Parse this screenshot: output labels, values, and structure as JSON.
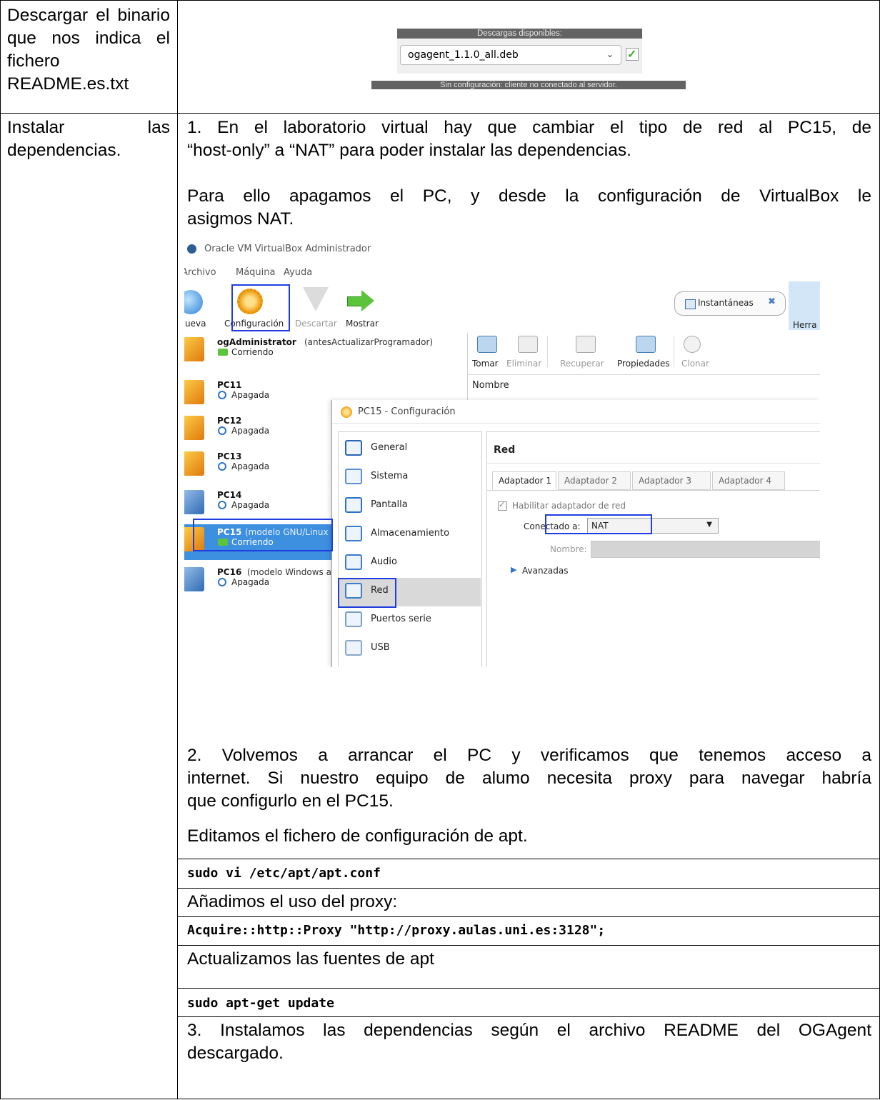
{
  "row1": {
    "label": "Descargar el binario que nos indica el fichero README.es.txt",
    "downloads_header": "Descargas disponibles:",
    "selected_file": "ogagent_1.1.0_all.deb",
    "status": "Sin configuración: cliente no conectado al servidor."
  },
  "row2": {
    "label_line1_a": "Instalar",
    "label_line1_b": "las",
    "label_line2": "dependencias.",
    "step1_line1": "1. En el laboratorio virtual hay que cambiar el tipo de red al PC15, de",
    "step1_line2": "“host-only” a “NAT” para poder instalar las dependencias.",
    "step1b_line1": "Para ello apagamos el PC, y desde la configuración de VirtualBox le",
    "step1b_line2": "asigmos NAT.",
    "step2_line1": "2. Volvemos a arrancar el PC y verificamos que tenemos acceso a",
    "step2_line2": "internet. Si nuestro equipo de alumo necesita proxy para navegar habría",
    "step2_line3": "que configurlo en el PC15.",
    "edit_text": "Editamos el fichero de configuración de apt.",
    "cmd1": "sudo vi /etc/apt/apt.conf",
    "proxy_text": "Añadimos el uso del proxy:",
    "cmd2": "Acquire::http::Proxy \"http://proxy.aulas.uni.es:3128\";",
    "update_text": "Actualizamos las fuentes de apt",
    "cmd3": "sudo apt-get update",
    "step3_line1": "3. Instalamos las dependencias según el archivo README del OGAgent",
    "step3_line2": "descargado."
  },
  "virtualbox": {
    "window_title": "Oracle VM VirtualBox Administrador",
    "menu": [
      "Archivo",
      "Máquina",
      "Ayuda"
    ],
    "toolbar": [
      "Nueva",
      "Configuración",
      "Descartar",
      "Mostrar"
    ],
    "snapshots_button": "Instantáneas",
    "tools_label": "Herra",
    "vms": [
      {
        "name": "ogAdministrator",
        "extra": "(antesActualizarProgramador)",
        "state": "Corriendo"
      },
      {
        "name": "PC11",
        "extra": "",
        "state": "Apagada"
      },
      {
        "name": "PC12",
        "extra": "",
        "state": "Apagada"
      },
      {
        "name": "PC13",
        "extra": "",
        "state": "Apagada"
      },
      {
        "name": "PC14",
        "extra": "",
        "state": "Apagada"
      },
      {
        "name": "PC15",
        "extra": "(modelo GNU/Linux",
        "state": "Corriendo"
      },
      {
        "name": "PC16",
        "extra": "(modelo Windows a",
        "state": "Apagada"
      }
    ],
    "snap_toolbar": [
      "Tomar",
      "Eliminar",
      "Recuperar",
      "Propiedades",
      "Clonar"
    ],
    "snap_column": "Nombre",
    "dialog_title": "PC15 - Configuración",
    "sections": [
      "General",
      "Sistema",
      "Pantalla",
      "Almacenamiento",
      "Audio",
      "Red",
      "Puertos serie",
      "USB"
    ],
    "panel_title": "Red",
    "tabs": [
      "Adaptador 1",
      "Adaptador 2",
      "Adaptador 3",
      "Adaptador 4"
    ],
    "enable_adapter": "Habilitar adaptador de red",
    "connected_label": "Conectado a:",
    "connected_value": "NAT",
    "name_label": "Nombre:",
    "advanced": "Avanzadas"
  }
}
